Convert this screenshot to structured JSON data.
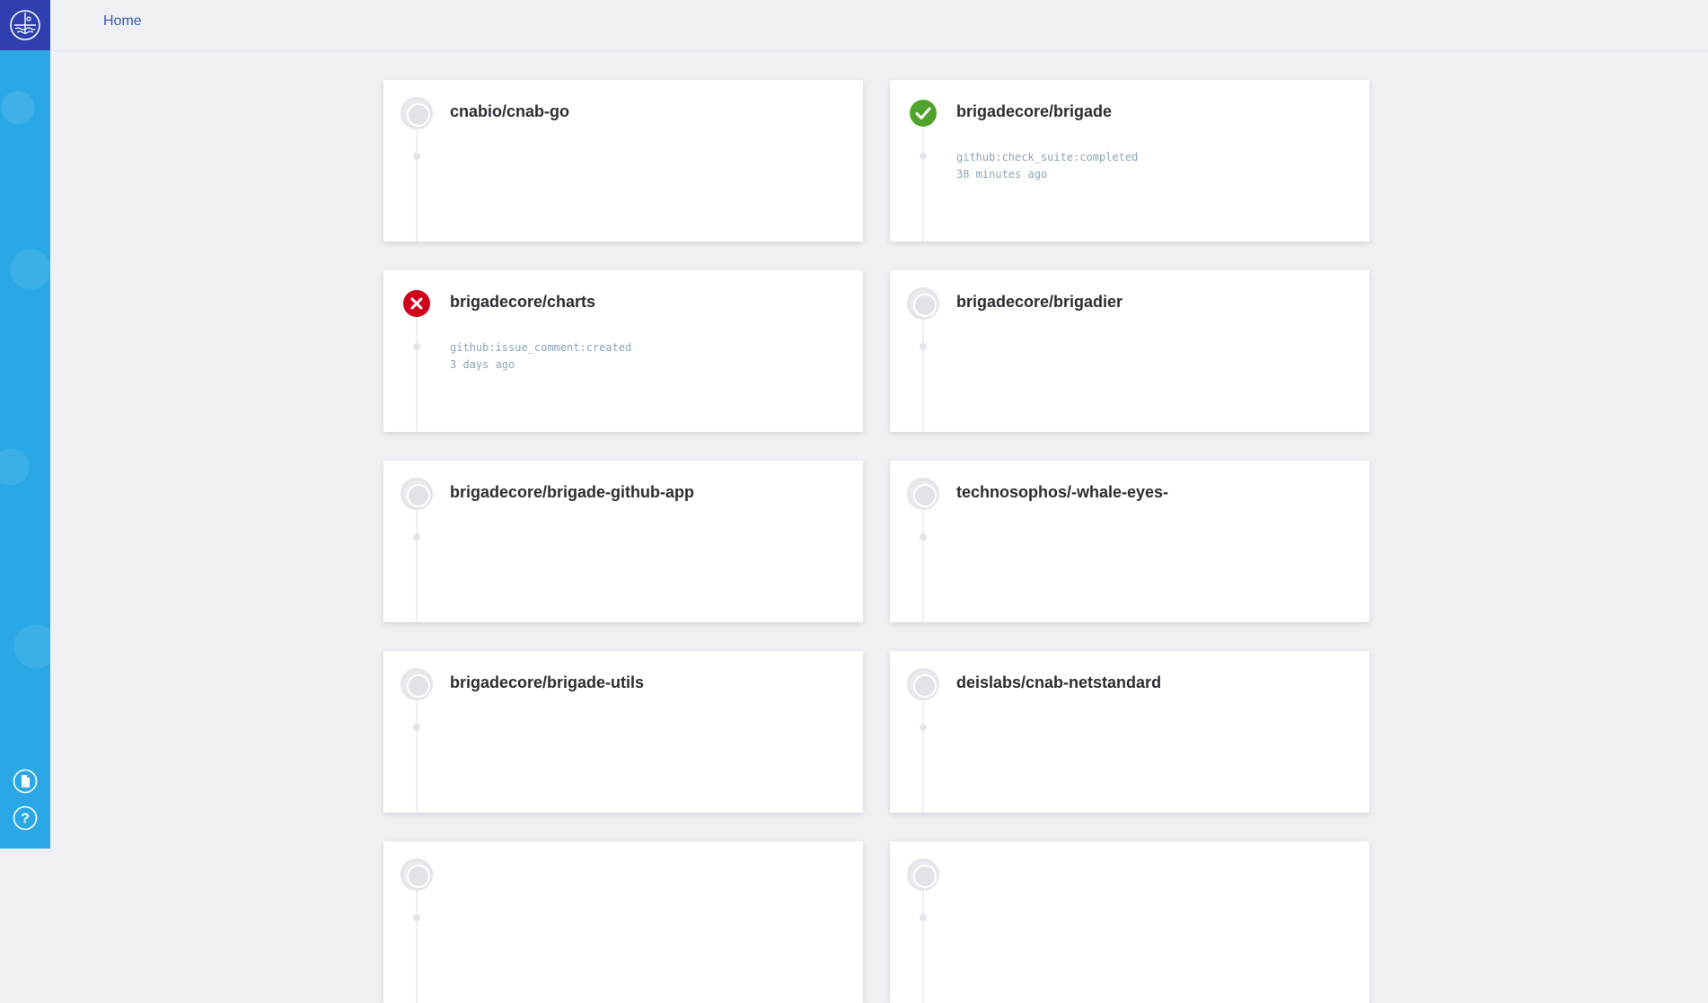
{
  "header": {
    "breadcrumb": "Home"
  },
  "sidebar": {
    "logo_icon": "brigade-logo-icon",
    "bottom_icons": [
      "document-icon",
      "help-icon"
    ]
  },
  "colors": {
    "sidebar": "#2aa8e6",
    "logo_bg": "#2f3fb0",
    "success": "#4fa32a",
    "failure": "#d0021b",
    "breadcrumb": "#3d5ab0"
  },
  "projects": [
    {
      "name": "cnabio/cnab-go",
      "status": "idle",
      "event": "",
      "time": ""
    },
    {
      "name": "brigadecore/brigade",
      "status": "success",
      "event": "github:check_suite:completed",
      "time": "38 minutes ago"
    },
    {
      "name": "brigadecore/charts",
      "status": "failure",
      "event": "github:issue_comment:created",
      "time": "3 days ago"
    },
    {
      "name": "brigadecore/brigadier",
      "status": "idle",
      "event": "",
      "time": ""
    },
    {
      "name": "brigadecore/brigade-github-app",
      "status": "idle",
      "event": "",
      "time": ""
    },
    {
      "name": "technosophos/-whale-eyes-",
      "status": "idle",
      "event": "",
      "time": ""
    },
    {
      "name": "brigadecore/brigade-utils",
      "status": "idle",
      "event": "",
      "time": ""
    },
    {
      "name": "deislabs/cnab-netstandard",
      "status": "idle",
      "event": "",
      "time": ""
    },
    {
      "name": "",
      "status": "idle",
      "event": "",
      "time": ""
    },
    {
      "name": "",
      "status": "idle",
      "event": "",
      "time": ""
    }
  ]
}
